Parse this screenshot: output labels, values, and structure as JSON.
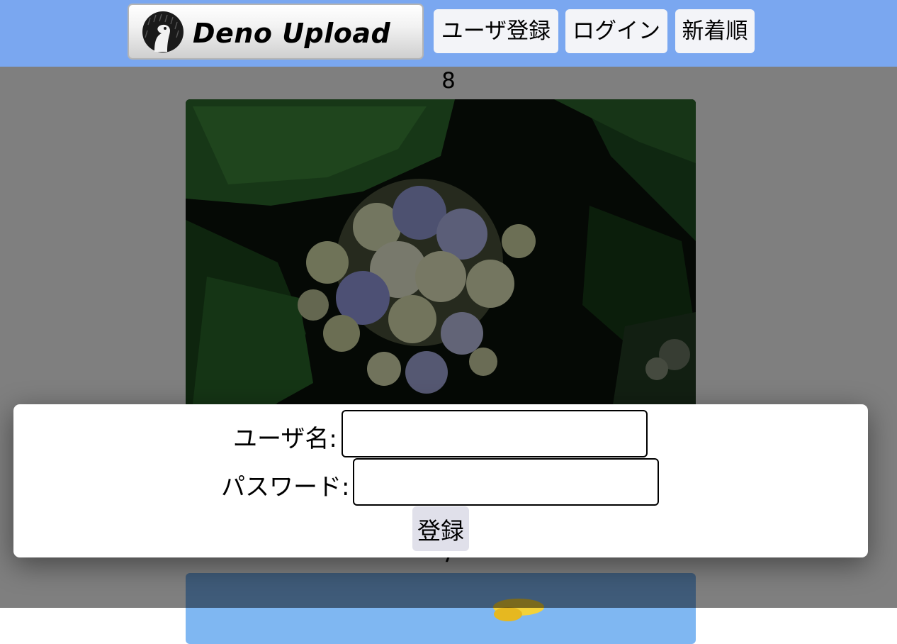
{
  "header": {
    "logo_text": "Deno Upload",
    "nav": [
      {
        "label": "ユーザ登録"
      },
      {
        "label": "ログイン"
      },
      {
        "label": "新着順"
      }
    ]
  },
  "posts": [
    {
      "number": "8",
      "image": "hydrangea-photo"
    },
    {
      "number": "7",
      "image": "yellow-flower-sky-photo"
    }
  ],
  "register_modal": {
    "username_label": "ユーザ名:",
    "username_value": "",
    "password_label": "パスワード:",
    "password_value": "",
    "submit_label": "登録"
  },
  "colors": {
    "header_bg": "#7aa7f0",
    "nav_button_bg": "#f3f4f8",
    "overlay": "rgba(0,0,0,0.5)",
    "modal_bg": "#ffffff",
    "submit_bg": "#e0e0ea"
  }
}
